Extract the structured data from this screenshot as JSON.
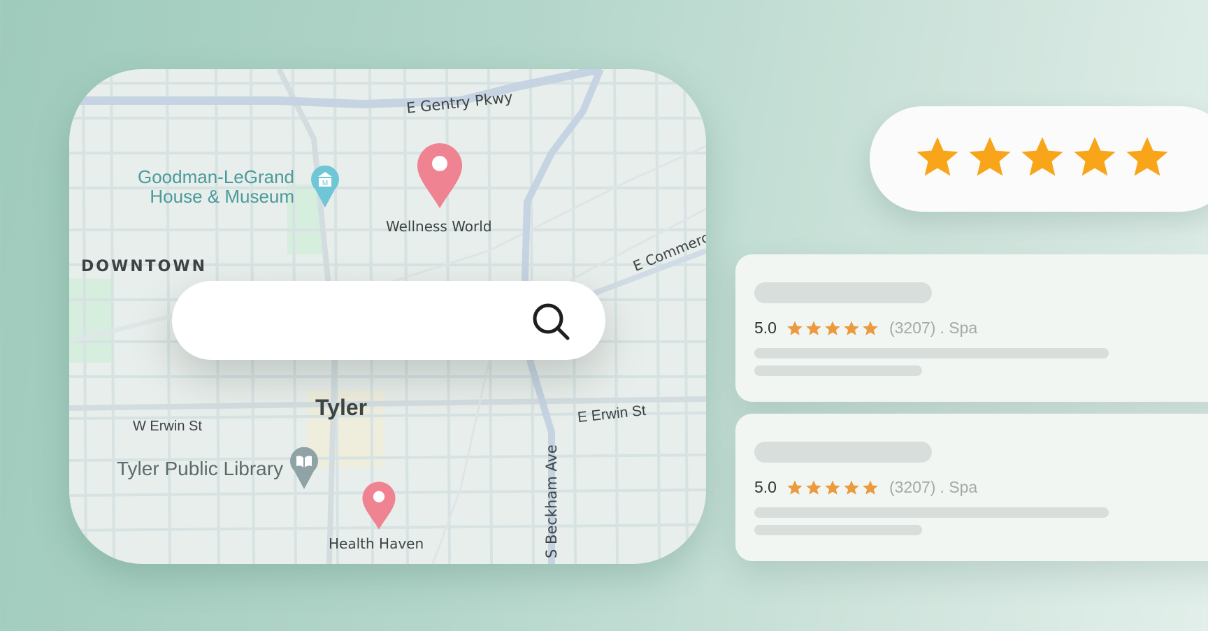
{
  "map": {
    "labels": {
      "gentry": "E Gentry Pkwy",
      "museum_line1": "Goodman-LeGrand",
      "museum_line2": "House & Museum",
      "wellness": "Wellness World",
      "downtown": "DOWNTOWN",
      "commerce": "E Commerce",
      "tyler": "Tyler",
      "w_erwin": "W Erwin St",
      "e_erwin": "E Erwin St",
      "library": "Tyler Public Library",
      "health": "Health Haven",
      "beckham": "S Beckham Ave"
    },
    "icons": {
      "pin": "map-pin-icon",
      "museum": "museum-icon",
      "library": "library-book-icon"
    },
    "colors": {
      "pin": "#f08391",
      "museum": "#6ec6d6",
      "library": "#8fa3a6",
      "museum_text": "#4a9a9a"
    }
  },
  "search": {
    "placeholder": "",
    "icon": "search-icon"
  },
  "rating_banner": {
    "stars": 5,
    "star_color": "#f9a51a"
  },
  "reviews": [
    {
      "rating": "5.0",
      "stars": 5,
      "count": "(3207)",
      "category": ". Spa"
    },
    {
      "rating": "5.0",
      "stars": 5,
      "count": "(3207)",
      "category": ". Spa"
    }
  ],
  "colors": {
    "review_star": "#ec9a3e"
  }
}
